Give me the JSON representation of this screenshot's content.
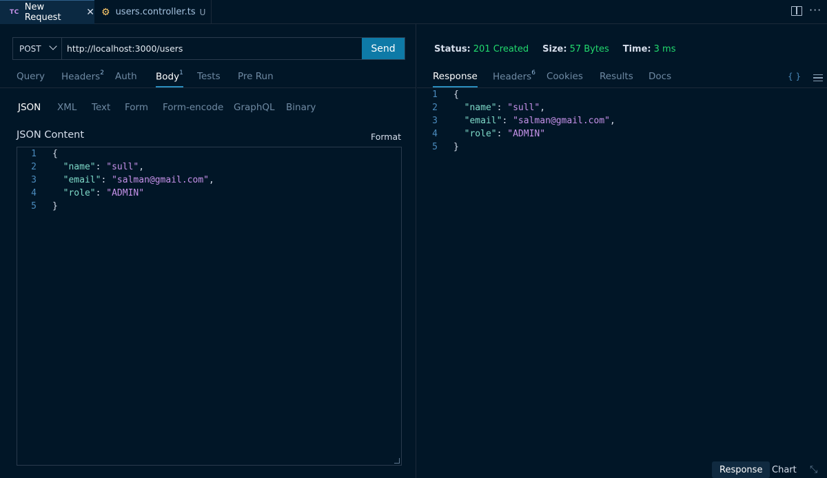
{
  "tabs": [
    {
      "icon": "TC",
      "label": "New Request",
      "close": "✕"
    },
    {
      "label": "users.controller.ts",
      "modified": "U"
    }
  ],
  "request": {
    "method": "POST",
    "url": "http://localhost:3000/users",
    "send_label": "Send",
    "tabs": [
      {
        "label": "Query"
      },
      {
        "label": "Headers",
        "badge": "2"
      },
      {
        "label": "Auth"
      },
      {
        "label": "Body",
        "badge": "1"
      },
      {
        "label": "Tests"
      },
      {
        "label": "Pre Run"
      }
    ],
    "body_tabs": [
      "JSON",
      "XML",
      "Text",
      "Form",
      "Form-encode",
      "GraphQL",
      "Binary"
    ],
    "json_title": "JSON Content",
    "format_label": "Format"
  },
  "body_lines": [
    {
      "n": "1",
      "parts": [
        [
          "p",
          "{"
        ]
      ]
    },
    {
      "n": "2",
      "parts": [
        [
          "p",
          "  "
        ],
        [
          "k",
          "\"name\""
        ],
        [
          "p",
          ": "
        ],
        [
          "s",
          "\"sull\""
        ],
        [
          "p",
          ","
        ]
      ]
    },
    {
      "n": "3",
      "parts": [
        [
          "p",
          "  "
        ],
        [
          "k",
          "\"email\""
        ],
        [
          "p",
          ": "
        ],
        [
          "s",
          "\"salman@gmail.com\""
        ],
        [
          "p",
          ","
        ]
      ]
    },
    {
      "n": "4",
      "parts": [
        [
          "p",
          "  "
        ],
        [
          "k",
          "\"role\""
        ],
        [
          "p",
          ": "
        ],
        [
          "s",
          "\"ADMIN\""
        ]
      ]
    },
    {
      "n": "5",
      "parts": [
        [
          "p",
          "}"
        ]
      ]
    }
  ],
  "response": {
    "status_label": "Status:",
    "status_value": "201 Created",
    "size_label": "Size:",
    "size_value": "57 Bytes",
    "time_label": "Time:",
    "time_value": "3 ms",
    "tabs": [
      {
        "label": "Response"
      },
      {
        "label": "Headers",
        "badge": "6"
      },
      {
        "label": "Cookies"
      },
      {
        "label": "Results"
      },
      {
        "label": "Docs"
      }
    ],
    "braces": "{ }",
    "bottom_response": "Response",
    "bottom_chart": "Chart"
  },
  "response_lines": [
    {
      "n": "1",
      "parts": [
        [
          "p",
          "{"
        ]
      ]
    },
    {
      "n": "2",
      "parts": [
        [
          "p",
          "  "
        ],
        [
          "k",
          "\"name\""
        ],
        [
          "p",
          ": "
        ],
        [
          "s",
          "\"sull\""
        ],
        [
          "p",
          ","
        ]
      ]
    },
    {
      "n": "3",
      "parts": [
        [
          "p",
          "  "
        ],
        [
          "k",
          "\"email\""
        ],
        [
          "p",
          ": "
        ],
        [
          "s",
          "\"salman@gmail.com\""
        ],
        [
          "p",
          ","
        ]
      ]
    },
    {
      "n": "4",
      "parts": [
        [
          "p",
          "  "
        ],
        [
          "k",
          "\"role\""
        ],
        [
          "p",
          ": "
        ],
        [
          "s",
          "\"ADMIN\""
        ]
      ]
    },
    {
      "n": "5",
      "parts": [
        [
          "p",
          "}"
        ]
      ]
    }
  ],
  "colors": {
    "accent": "#0e7aa7",
    "status_ok": "#22da6e",
    "key": "#7fdbca",
    "string": "#c792ea"
  }
}
